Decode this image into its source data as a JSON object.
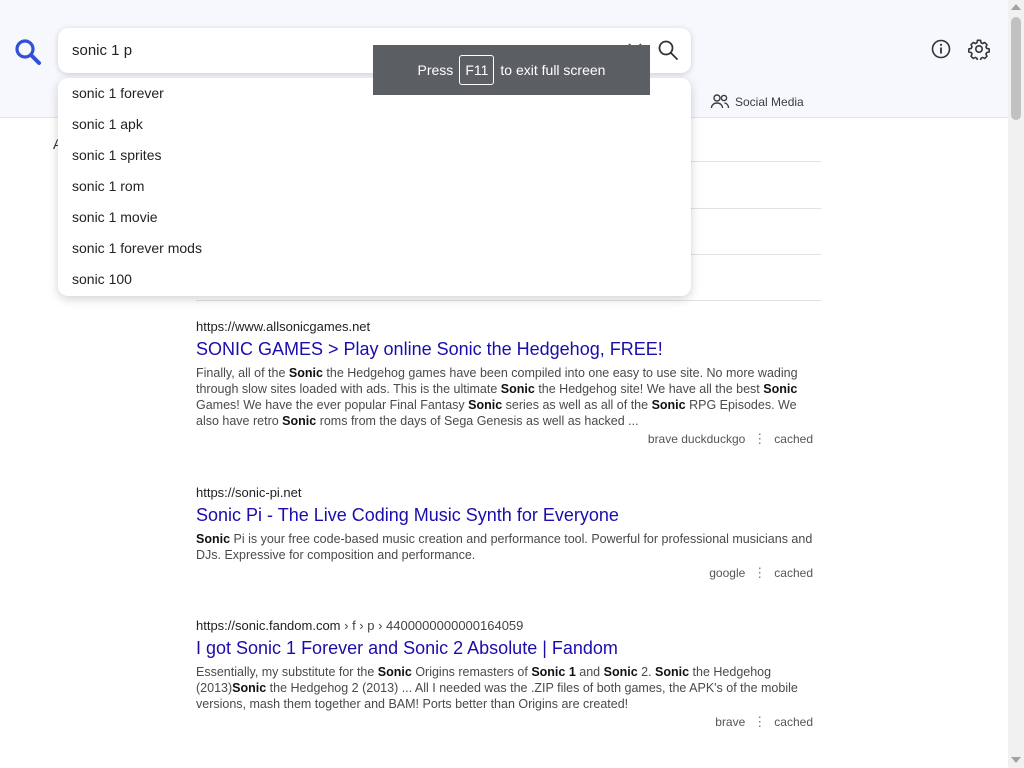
{
  "search": {
    "value": "sonic 1 p",
    "suggestions": [
      "sonic 1 forever",
      "sonic 1 apk",
      "sonic 1 sprites",
      "sonic 1 rom",
      "sonic 1 movie",
      "sonic 1 forever mods",
      "sonic 100"
    ]
  },
  "fullscreen_toast": {
    "prefix": "Press",
    "key": "F11",
    "suffix": "to exit full screen"
  },
  "tabs": {
    "social_media": "Social Media"
  },
  "side_letter": "A",
  "results": [
    {
      "url": "https://www.allsonicgames.net",
      "path": "",
      "title": "SONIC GAMES > Play online Sonic the Hedgehog, FREE!",
      "snippet_html": "Finally, all of the <b>Sonic</b> the Hedgehog games have been compiled into one easy to use site. No more wading through slow sites loaded with ads. This is the ultimate <b>Sonic</b> the Hedgehog site! We have all the best <b>Sonic</b> Games! We have the ever popular Final Fantasy <b>Sonic</b> series as well as all of the <b>Sonic</b> RPG Episodes. We also have retro <b>Sonic</b> roms from the days of Sega Genesis as well as hacked ...",
      "engines": "brave  duckduckgo",
      "cached": "cached"
    },
    {
      "url": "https://sonic-pi.net",
      "path": "",
      "title": "Sonic Pi - The Live Coding Music Synth for Everyone",
      "snippet_html": "<b>Sonic</b> Pi is your free code-based music creation and performance tool. Powerful for professional musicians and DJs. Expressive for composition and performance.",
      "engines": "google",
      "cached": "cached"
    },
    {
      "url": "https://sonic.fandom.com",
      "path": " › f › p › 4400000000000164059",
      "title": "I got Sonic 1 Forever and Sonic 2 Absolute | Fandom",
      "snippet_html": "Essentially, my substitute for the <b>Sonic</b> Origins remasters of <b>Sonic 1</b> and <b>Sonic</b> 2. <b>Sonic</b> the Hedgehog (2013)<b>Sonic</b> the Hedgehog 2 (2013) ... All I needed was the .ZIP files of both games, the APK's of the mobile versions, mash them together and BAM! Ports better than Origins are created!",
      "engines": "brave",
      "cached": "cached"
    }
  ],
  "colors": {
    "accent": "#3050d8",
    "link": "#1a0dab",
    "header_bg": "#f7f8fd",
    "toast_bg": "#5b5f63"
  }
}
